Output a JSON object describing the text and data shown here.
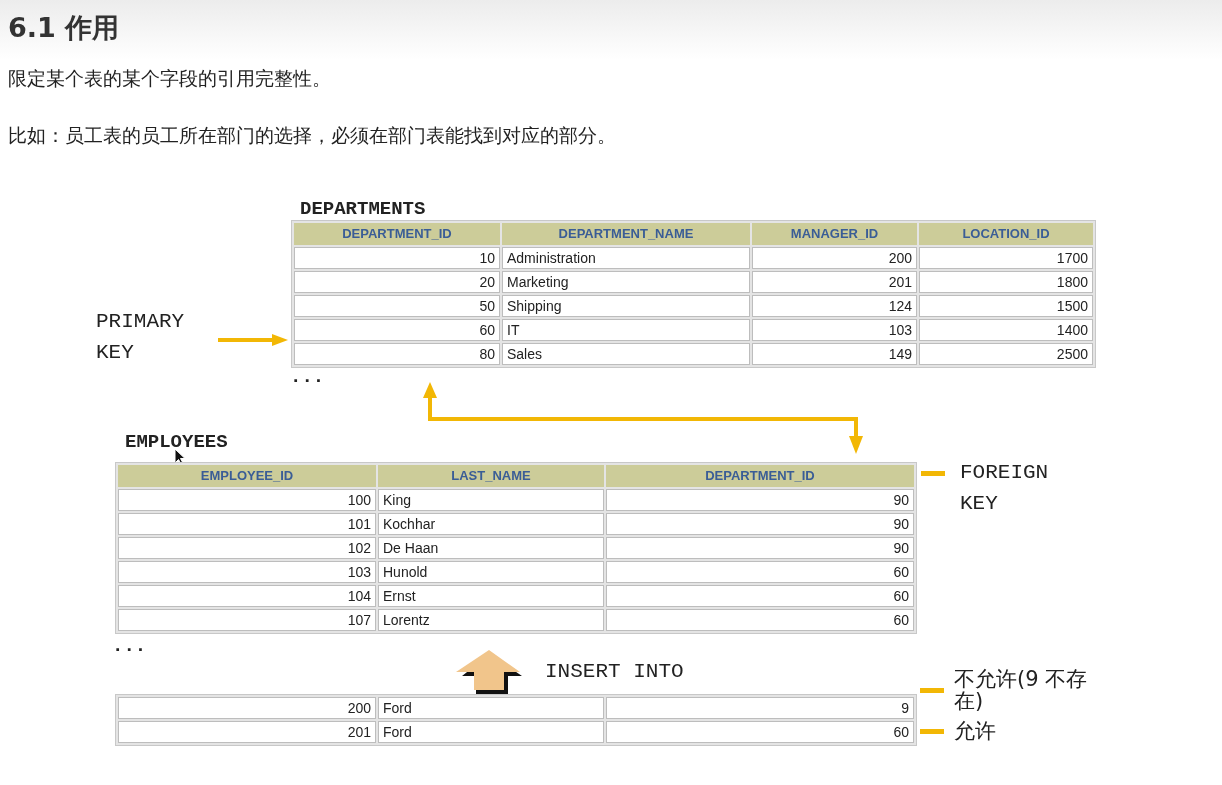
{
  "heading": "6.1 作用",
  "paragraphs": [
    "限定某个表的某个字段的引用完整性。",
    "比如：员工表的员工所在部门的选择，必须在部门表能找到对应的部分。"
  ],
  "figure": {
    "departments": {
      "title": "DEPARTMENTS",
      "columns": [
        {
          "label": "DEPARTMENT_ID",
          "kind": "number"
        },
        {
          "label": "DEPARTMENT_NAME",
          "kind": "text"
        },
        {
          "label": "MANAGER_ID",
          "kind": "number"
        },
        {
          "label": "LOCATION_ID",
          "kind": "number"
        }
      ],
      "rows": [
        [
          "10",
          "Administration",
          "200",
          "1700"
        ],
        [
          "20",
          "Marketing",
          "201",
          "1800"
        ],
        [
          "50",
          "Shipping",
          "124",
          "1500"
        ],
        [
          "60",
          "IT",
          "103",
          "1400"
        ],
        [
          "80",
          "Sales",
          "149",
          "2500"
        ]
      ],
      "more": "..."
    },
    "primary_key_label": "PRIMARY\nKEY",
    "employees": {
      "title": "EMPLOYEES",
      "columns": [
        {
          "label": "EMPLOYEE_ID",
          "kind": "number"
        },
        {
          "label": "LAST_NAME",
          "kind": "text"
        },
        {
          "label": "DEPARTMENT_ID",
          "kind": "number"
        }
      ],
      "rows": [
        [
          "100",
          "King",
          "90"
        ],
        [
          "101",
          "Kochhar",
          "90"
        ],
        [
          "102",
          "De Haan",
          "90"
        ],
        [
          "103",
          "Hunold",
          "60"
        ],
        [
          "104",
          "Ernst",
          "60"
        ],
        [
          "107",
          "Lorentz",
          "60"
        ]
      ],
      "more": "..."
    },
    "foreign_key_label": "FOREIGN\nKEY",
    "insert_label": "INSERT INTO",
    "inserted_rows": [
      {
        "cells": [
          "200",
          "Ford",
          "9"
        ],
        "note": "不允许(9 不存在)"
      },
      {
        "cells": [
          "201",
          "Ford",
          "60"
        ],
        "note": "允许"
      }
    ]
  }
}
